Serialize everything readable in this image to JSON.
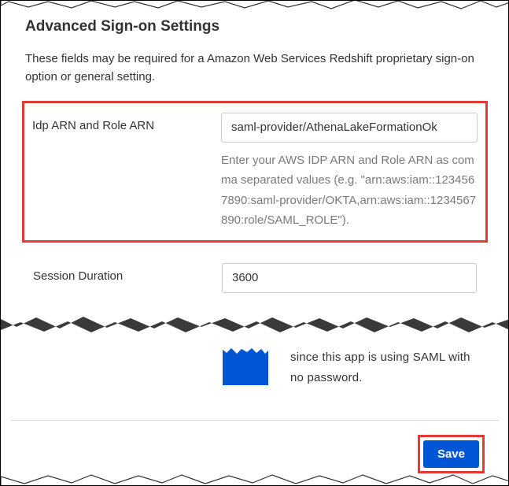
{
  "title": "Advanced Sign-on Settings",
  "description": "These fields may be required for a Amazon Web Services Redshift proprietary sign-on option or general setting.",
  "fields": {
    "arn": {
      "label": "Idp ARN and Role ARN",
      "value": "saml-provider/AthenaLakeFormationOk",
      "hint": "Enter your AWS IDP ARN and Role ARN as comma separated values (e.g. \"arn:aws:iam::1234567890:saml-provider/OKTA,arn:aws:iam::1234567890:role/SAML_ROLE\")."
    },
    "session": {
      "label": "Session Duration",
      "value": "3600"
    }
  },
  "info_fragment": "since this app is using SAML with no password.",
  "buttons": {
    "save": "Save"
  }
}
